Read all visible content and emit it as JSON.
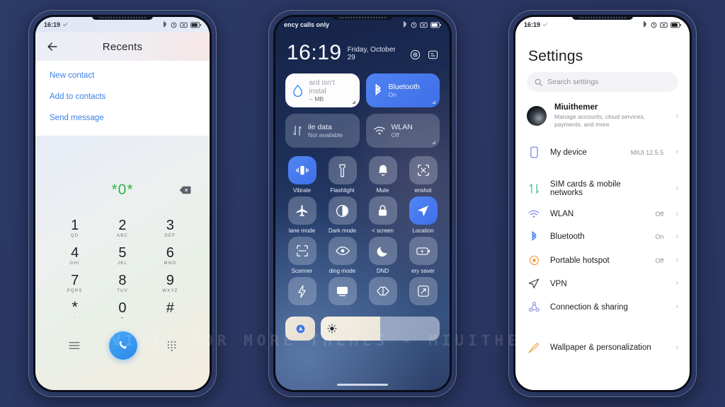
{
  "background_color": "#2b3a66",
  "watermark": "VISIT FOR MORE THEMES - MIUITHEMER.COM",
  "accent_blue": "#3c82e8",
  "active_tile_blue": "#4f82f2",
  "phone1": {
    "status_bar": {
      "time": "16:19",
      "icons": [
        "bluetooth-icon",
        "alarm-icon",
        "vibrate-icon",
        "battery-icon"
      ]
    },
    "header": {
      "back": "back-arrow-icon",
      "title": "Recents"
    },
    "actions": [
      {
        "label": "New contact"
      },
      {
        "label": "Add to contacts"
      },
      {
        "label": "Send message"
      }
    ],
    "dialer": {
      "number": "*0*",
      "delete_icon": "backspace-icon",
      "keys": [
        {
          "digit": "1",
          "letters": "QD"
        },
        {
          "digit": "2",
          "letters": "ABC"
        },
        {
          "digit": "3",
          "letters": "DEF"
        },
        {
          "digit": "4",
          "letters": "GHI"
        },
        {
          "digit": "5",
          "letters": "JKL"
        },
        {
          "digit": "6",
          "letters": "MNO"
        },
        {
          "digit": "7",
          "letters": "PQRS"
        },
        {
          "digit": "8",
          "letters": "TUV"
        },
        {
          "digit": "9",
          "letters": "WXYZ"
        },
        {
          "digit": "*",
          "letters": ","
        },
        {
          "digit": "0",
          "letters": "+"
        },
        {
          "digit": "#",
          "letters": ""
        }
      ],
      "bottom_bar": [
        "menu-icon",
        "call-button",
        "keypad-icon"
      ]
    }
  },
  "phone2": {
    "status_bar": {
      "carrier": "ency calls only",
      "icons": [
        "bluetooth-icon",
        "alarm-icon",
        "vibrate-icon",
        "battery-icon"
      ]
    },
    "clock": {
      "time": "16:19",
      "date": "Friday, October 29"
    },
    "header_icons": [
      "settings-gear-icon",
      "notes-icon"
    ],
    "big_tiles": [
      {
        "name": "data-usage",
        "title": "ard isn't instal",
        "subtitle": "-- MB",
        "state": "light",
        "icon": "water-drop-icon"
      },
      {
        "name": "bluetooth",
        "title": "Bluetooth",
        "subtitle": "On",
        "state": "on",
        "icon": "bluetooth-icon"
      },
      {
        "name": "mobile-data",
        "title": "ile data",
        "subtitle": "Not available",
        "state": "off",
        "icon": "mobile-data-icon"
      },
      {
        "name": "wlan",
        "title": "WLAN",
        "subtitle": "Off",
        "state": "off",
        "icon": "wifi-icon"
      }
    ],
    "tiles": [
      {
        "label": "Vibrate",
        "icon": "vibrate-icon",
        "active": true
      },
      {
        "label": "Flashlight",
        "icon": "flashlight-icon",
        "active": false
      },
      {
        "label": "Mute",
        "icon": "bell-icon",
        "active": false
      },
      {
        "label": "enshot",
        "icon": "screenshot-icon",
        "active": false
      },
      {
        "label": "lane mode",
        "icon": "airplane-icon",
        "active": false
      },
      {
        "label": "Dark mode",
        "icon": "contrast-icon",
        "active": false
      },
      {
        "label": "< screen",
        "icon": "lock-icon",
        "active": false
      },
      {
        "label": "Location",
        "icon": "location-arrow-icon",
        "active": true
      },
      {
        "label": "Scanner",
        "icon": "scanner-icon",
        "active": false
      },
      {
        "label": "ding mode",
        "icon": "eye-icon",
        "active": false
      },
      {
        "label": "DND",
        "icon": "moon-icon",
        "active": false
      },
      {
        "label": "ery saver",
        "icon": "battery-saver-icon",
        "active": false
      },
      {
        "label": "",
        "icon": "lightning-icon",
        "active": false
      },
      {
        "label": "",
        "icon": "cast-icon",
        "active": false
      },
      {
        "label": "",
        "icon": "sync-icon",
        "active": false
      },
      {
        "label": "",
        "icon": "rotate-icon",
        "active": false
      }
    ],
    "brightness": {
      "auto_icon": "auto-brightness-icon",
      "slider_icon": "brightness-sun-icon",
      "value_percent": 50
    }
  },
  "phone3": {
    "status_bar": {
      "time": "16:19",
      "icons": [
        "bluetooth-icon",
        "alarm-icon",
        "vibrate-icon",
        "battery-icon"
      ]
    },
    "title": "Settings",
    "search_placeholder": "Search settings",
    "account": {
      "name": "Miuithemer",
      "subtitle": "Manage accounts, cloud services, payments, and more",
      "icon": "avatar"
    },
    "rows_group1": [
      {
        "label": "My device",
        "value": "MIUI 12.5.5",
        "icon": "phone-device-icon",
        "icon_color": "#6b7ce8"
      }
    ],
    "rows_group2": [
      {
        "label": "SIM cards & mobile networks",
        "value": "",
        "icon": "sim-network-icon",
        "icon_color": "#3fc39a"
      },
      {
        "label": "WLAN",
        "value": "Off",
        "icon": "wifi-icon",
        "icon_color": "#7b86ef"
      },
      {
        "label": "Bluetooth",
        "value": "On",
        "icon": "bluetooth-icon",
        "icon_color": "#4b8bf0"
      },
      {
        "label": "Portable hotspot",
        "value": "Off",
        "icon": "hotspot-icon",
        "icon_color": "#f29c3d"
      },
      {
        "label": "VPN",
        "value": "",
        "icon": "vpn-send-icon",
        "icon_color": "#3a3f48"
      },
      {
        "label": "Connection & sharing",
        "value": "",
        "icon": "sharing-icon",
        "icon_color": "#8a8fe3"
      }
    ],
    "rows_group3": [
      {
        "label": "Wallpaper & personalization",
        "value": "",
        "icon": "wallpaper-brush-icon",
        "icon_color": "#f0a044"
      }
    ],
    "chevron": "›"
  }
}
